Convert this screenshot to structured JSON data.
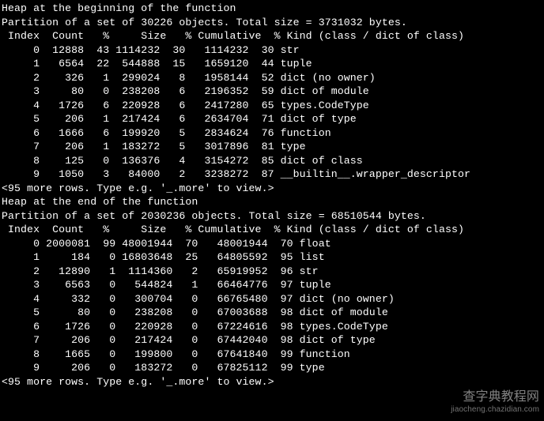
{
  "header1": "Heap at the beginning of the function",
  "header2": "Heap at the end of the function",
  "partition1": "Partition of a set of 30226 objects. Total size = 3731032 bytes.",
  "partition2": "Partition of a set of 2030236 objects. Total size = 68510544 bytes.",
  "more_rows": "<95 more rows. Type e.g. '_.more' to view.>",
  "cols": " Index  Count   %     Size   % Cumulative  % Kind (class / dict of class)",
  "t1": [
    {
      "idx": 0,
      "count": 12888,
      "pct": 43,
      "size": 1114232,
      "spct": 30,
      "cum": 1114232,
      "cpct": 30,
      "kind": "str"
    },
    {
      "idx": 1,
      "count": 6564,
      "pct": 22,
      "size": 544888,
      "spct": 15,
      "cum": 1659120,
      "cpct": 44,
      "kind": "tuple"
    },
    {
      "idx": 2,
      "count": 326,
      "pct": 1,
      "size": 299024,
      "spct": 8,
      "cum": 1958144,
      "cpct": 52,
      "kind": "dict (no owner)"
    },
    {
      "idx": 3,
      "count": 80,
      "pct": 0,
      "size": 238208,
      "spct": 6,
      "cum": 2196352,
      "cpct": 59,
      "kind": "dict of module"
    },
    {
      "idx": 4,
      "count": 1726,
      "pct": 6,
      "size": 220928,
      "spct": 6,
      "cum": 2417280,
      "cpct": 65,
      "kind": "types.CodeType"
    },
    {
      "idx": 5,
      "count": 206,
      "pct": 1,
      "size": 217424,
      "spct": 6,
      "cum": 2634704,
      "cpct": 71,
      "kind": "dict of type"
    },
    {
      "idx": 6,
      "count": 1666,
      "pct": 6,
      "size": 199920,
      "spct": 5,
      "cum": 2834624,
      "cpct": 76,
      "kind": "function"
    },
    {
      "idx": 7,
      "count": 206,
      "pct": 1,
      "size": 183272,
      "spct": 5,
      "cum": 3017896,
      "cpct": 81,
      "kind": "type"
    },
    {
      "idx": 8,
      "count": 125,
      "pct": 0,
      "size": 136376,
      "spct": 4,
      "cum": 3154272,
      "cpct": 85,
      "kind": "dict of class"
    },
    {
      "idx": 9,
      "count": 1050,
      "pct": 3,
      "size": 84000,
      "spct": 2,
      "cum": 3238272,
      "cpct": 87,
      "kind": "__builtin__.wrapper_descriptor"
    }
  ],
  "t2": [
    {
      "idx": 0,
      "count": 2000081,
      "pct": 99,
      "size": 48001944,
      "spct": 70,
      "cum": 48001944,
      "cpct": 70,
      "kind": "float"
    },
    {
      "idx": 1,
      "count": 184,
      "pct": 0,
      "size": 16803648,
      "spct": 25,
      "cum": 64805592,
      "cpct": 95,
      "kind": "list"
    },
    {
      "idx": 2,
      "count": 12890,
      "pct": 1,
      "size": 1114360,
      "spct": 2,
      "cum": 65919952,
      "cpct": 96,
      "kind": "str"
    },
    {
      "idx": 3,
      "count": 6563,
      "pct": 0,
      "size": 544824,
      "spct": 1,
      "cum": 66464776,
      "cpct": 97,
      "kind": "tuple"
    },
    {
      "idx": 4,
      "count": 332,
      "pct": 0,
      "size": 300704,
      "spct": 0,
      "cum": 66765480,
      "cpct": 97,
      "kind": "dict (no owner)"
    },
    {
      "idx": 5,
      "count": 80,
      "pct": 0,
      "size": 238208,
      "spct": 0,
      "cum": 67003688,
      "cpct": 98,
      "kind": "dict of module"
    },
    {
      "idx": 6,
      "count": 1726,
      "pct": 0,
      "size": 220928,
      "spct": 0,
      "cum": 67224616,
      "cpct": 98,
      "kind": "types.CodeType"
    },
    {
      "idx": 7,
      "count": 206,
      "pct": 0,
      "size": 217424,
      "spct": 0,
      "cum": 67442040,
      "cpct": 98,
      "kind": "dict of type"
    },
    {
      "idx": 8,
      "count": 1665,
      "pct": 0,
      "size": 199800,
      "spct": 0,
      "cum": 67641840,
      "cpct": 99,
      "kind": "function"
    },
    {
      "idx": 9,
      "count": 206,
      "pct": 0,
      "size": 183272,
      "spct": 0,
      "cum": 67825112,
      "cpct": 99,
      "kind": "type"
    }
  ],
  "watermark": "查字典教程网",
  "suburl": "jiaocheng.chazidian.com",
  "chart_data": [
    {
      "type": "table",
      "title": "Heap at the beginning of the function",
      "subtitle": "Partition of a set of 30226 objects. Total size = 3731032 bytes.",
      "columns": [
        "Index",
        "Count",
        "%",
        "Size",
        "%",
        "Cumulative",
        "%",
        "Kind (class / dict of class)"
      ],
      "rows": [
        [
          0,
          12888,
          43,
          1114232,
          30,
          1114232,
          30,
          "str"
        ],
        [
          1,
          6564,
          22,
          544888,
          15,
          1659120,
          44,
          "tuple"
        ],
        [
          2,
          326,
          1,
          299024,
          8,
          1958144,
          52,
          "dict (no owner)"
        ],
        [
          3,
          80,
          0,
          238208,
          6,
          2196352,
          59,
          "dict of module"
        ],
        [
          4,
          1726,
          6,
          220928,
          6,
          2417280,
          65,
          "types.CodeType"
        ],
        [
          5,
          206,
          1,
          217424,
          6,
          2634704,
          71,
          "dict of type"
        ],
        [
          6,
          1666,
          6,
          199920,
          5,
          2834624,
          76,
          "function"
        ],
        [
          7,
          206,
          1,
          183272,
          5,
          3017896,
          81,
          "type"
        ],
        [
          8,
          125,
          0,
          136376,
          4,
          3154272,
          85,
          "dict of class"
        ],
        [
          9,
          1050,
          3,
          84000,
          2,
          3238272,
          87,
          "__builtin__.wrapper_descriptor"
        ]
      ]
    },
    {
      "type": "table",
      "title": "Heap at the end of the function",
      "subtitle": "Partition of a set of 2030236 objects. Total size = 68510544 bytes.",
      "columns": [
        "Index",
        "Count",
        "%",
        "Size",
        "%",
        "Cumulative",
        "%",
        "Kind (class / dict of class)"
      ],
      "rows": [
        [
          0,
          2000081,
          99,
          48001944,
          70,
          48001944,
          70,
          "float"
        ],
        [
          1,
          184,
          0,
          16803648,
          25,
          64805592,
          95,
          "list"
        ],
        [
          2,
          12890,
          1,
          1114360,
          2,
          65919952,
          96,
          "str"
        ],
        [
          3,
          6563,
          0,
          544824,
          1,
          66464776,
          97,
          "tuple"
        ],
        [
          4,
          332,
          0,
          300704,
          0,
          66765480,
          97,
          "dict (no owner)"
        ],
        [
          5,
          80,
          0,
          238208,
          0,
          67003688,
          98,
          "dict of module"
        ],
        [
          6,
          1726,
          0,
          220928,
          0,
          67224616,
          98,
          "types.CodeType"
        ],
        [
          7,
          206,
          0,
          217424,
          0,
          67442040,
          98,
          "dict of type"
        ],
        [
          8,
          1665,
          0,
          199800,
          0,
          67641840,
          99,
          "function"
        ],
        [
          9,
          206,
          0,
          183272,
          0,
          67825112,
          99,
          "type"
        ]
      ]
    }
  ]
}
